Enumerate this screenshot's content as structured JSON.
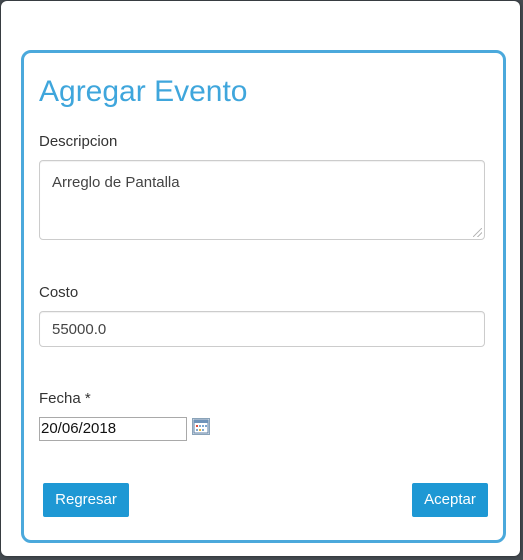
{
  "dialog": {
    "title": "Agregar Evento"
  },
  "form": {
    "descripcion": {
      "label": "Descripcion",
      "value": "Arreglo de Pantalla"
    },
    "costo": {
      "label": "Costo",
      "value": "55000.0"
    },
    "fecha": {
      "label": "Fecha *",
      "value": "20/06/2018",
      "picker_icon": "calendar-icon"
    }
  },
  "actions": {
    "back_label": "Regresar",
    "accept_label": "Aceptar"
  },
  "colors": {
    "accent": "#3fa6dc",
    "panel_border": "#4ba9dc",
    "button": "#1e98d4"
  }
}
